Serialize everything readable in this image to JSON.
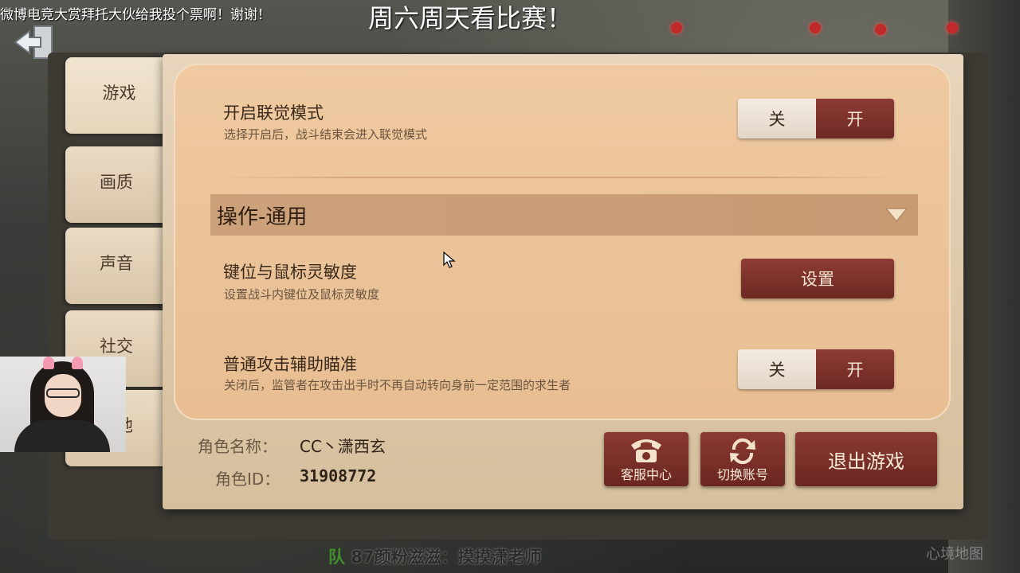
{
  "overlay": {
    "marquee": "微博电竞大赏拜托大伙给我投个票啊！谢谢！",
    "headline": "周六周天看比赛！"
  },
  "tabs": [
    {
      "label": "游戏",
      "active": true
    },
    {
      "label": "画质",
      "active": false
    },
    {
      "label": "声音",
      "active": false
    },
    {
      "label": "社交",
      "active": false
    },
    {
      "label": "其他",
      "active": false
    }
  ],
  "settings": {
    "linked_mode": {
      "title": "开启联觉模式",
      "desc": "选择开启后，战斗结束会进入联觉模式",
      "off": "关",
      "on": "开"
    },
    "section": {
      "label": "操作-通用"
    },
    "keybind": {
      "title": "键位与鼠标灵敏度",
      "desc": "设置战斗内键位及鼠标灵敏度",
      "button": "设置"
    },
    "aim_assist": {
      "title": "普通攻击辅助瞄准",
      "desc": "关闭后，监管者在攻击出手时不再自动转向身前一定范围的求生者",
      "off": "关",
      "on": "开"
    }
  },
  "profile": {
    "name_label": "角色名称：",
    "name_value": "CC丶潇西玄",
    "id_label": "角色ID：",
    "id_value": "31908772"
  },
  "actions": {
    "support": "客服中心",
    "switch_account": "切换账号",
    "exit": "退出游戏"
  },
  "chat": {
    "team": "队",
    "message": "87颜粉滋滋：摸摸潇老师"
  },
  "map_label": "心境地图",
  "colors": {
    "accent_red": "#7c3129",
    "parchment": "#e8be92",
    "section_bar": "#c89b73"
  }
}
